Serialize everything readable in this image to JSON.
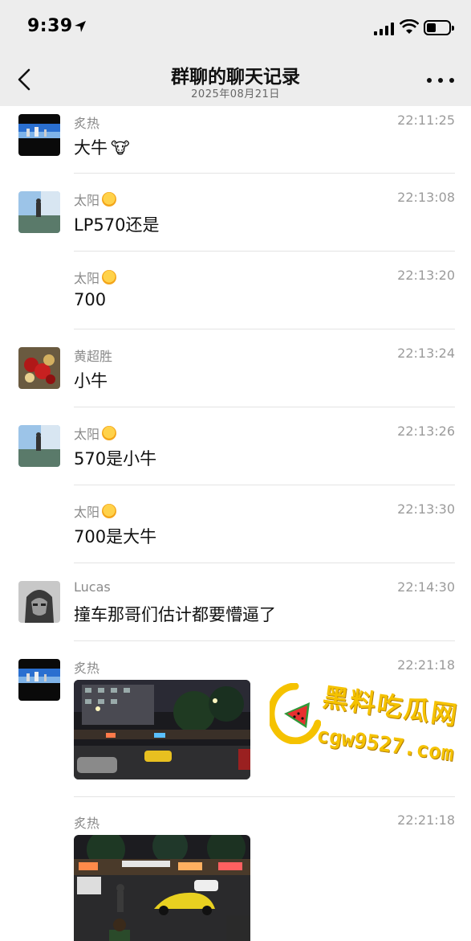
{
  "status_bar": {
    "time": "9:39"
  },
  "nav": {
    "title": "群聊的聊天记录",
    "subtitle": "2025年08月21日"
  },
  "messages": [
    {
      "sender": "炙热",
      "time": "22:11:25",
      "text": "大牛",
      "emoji": "🐮"
    },
    {
      "sender": "太阳",
      "time": "22:13:08",
      "text": "LP570还是"
    },
    {
      "sender": "太阳",
      "time": "22:13:20",
      "text": "700"
    },
    {
      "sender": "黄超胜",
      "time": "22:13:24",
      "text": "小牛"
    },
    {
      "sender": "太阳",
      "time": "22:13:26",
      "text": "570是小牛"
    },
    {
      "sender": "太阳",
      "time": "22:13:30",
      "text": "700是大牛"
    },
    {
      "sender": "Lucas",
      "time": "22:14:30",
      "text": "撞车那哥们估计都要懵逼了"
    },
    {
      "sender": "炙热",
      "time": "22:21:18",
      "image": "night-street-photo"
    },
    {
      "sender": "炙热",
      "time": "22:21:18",
      "image": "yellow-car-photo"
    }
  ],
  "watermark": {
    "text": "黑料吃瓜网",
    "url": "cgw9527.com"
  },
  "colors": {
    "header_bg": "#ededed",
    "sender": "#8a8a8a",
    "time": "#9b9b9b",
    "divider": "#e4e4e4",
    "watermark": "#f5c200"
  }
}
